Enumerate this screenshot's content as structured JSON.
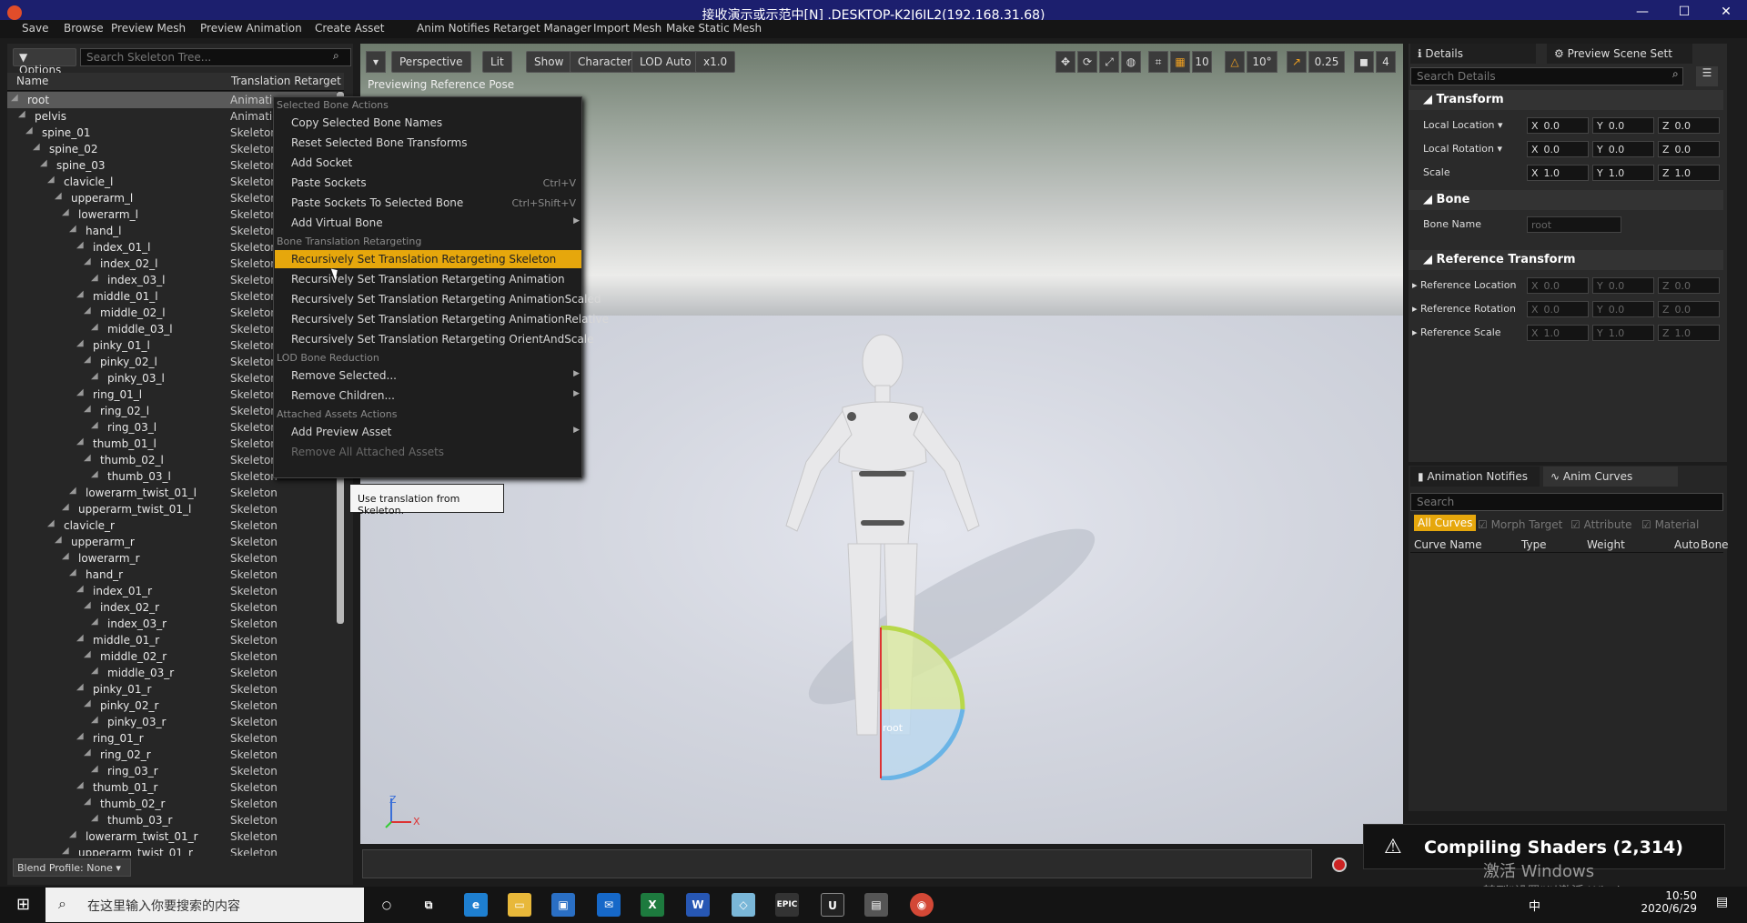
{
  "window": {
    "title": "接收演示或示范中[N] .DESKTOP-K2J6IL2(192.168.31.68)"
  },
  "menu": {
    "items": [
      "Save",
      "Browse",
      "Preview Mesh",
      "Preview Animation",
      "Create Asset",
      "Anim Notifies",
      "Retarget Manager",
      "Import Mesh",
      "Make Static Mesh"
    ]
  },
  "tree": {
    "options_label": "Options",
    "search_placeholder": "Search Skeleton Tree...",
    "col_name": "Name",
    "col_type": "Translation Retarget",
    "rows": [
      {
        "name": "root",
        "type": "Animatio",
        "indent": 0,
        "selected": true
      },
      {
        "name": "pelvis",
        "type": "Animatio",
        "indent": 1
      },
      {
        "name": "spine_01",
        "type": "Skeleton",
        "indent": 2
      },
      {
        "name": "spine_02",
        "type": "Skeleton",
        "indent": 3
      },
      {
        "name": "spine_03",
        "type": "Skeleton",
        "indent": 4
      },
      {
        "name": "clavicle_l",
        "type": "Skeleton",
        "indent": 5
      },
      {
        "name": "upperarm_l",
        "type": "Skeleton",
        "indent": 6
      },
      {
        "name": "lowerarm_l",
        "type": "Skeleton",
        "indent": 7
      },
      {
        "name": "hand_l",
        "type": "Skeleton",
        "indent": 8
      },
      {
        "name": "index_01_l",
        "type": "Skeleton",
        "indent": 9
      },
      {
        "name": "index_02_l",
        "type": "Skeleton",
        "indent": 10
      },
      {
        "name": "index_03_l",
        "type": "Skeleton",
        "indent": 11
      },
      {
        "name": "middle_01_l",
        "type": "Skeleton",
        "indent": 9
      },
      {
        "name": "middle_02_l",
        "type": "Skeleton",
        "indent": 10
      },
      {
        "name": "middle_03_l",
        "type": "Skeleton",
        "indent": 11
      },
      {
        "name": "pinky_01_l",
        "type": "Skeleton",
        "indent": 9
      },
      {
        "name": "pinky_02_l",
        "type": "Skeleton",
        "indent": 10
      },
      {
        "name": "pinky_03_l",
        "type": "Skeleton",
        "indent": 11
      },
      {
        "name": "ring_01_l",
        "type": "Skeleton",
        "indent": 9
      },
      {
        "name": "ring_02_l",
        "type": "Skeleton",
        "indent": 10
      },
      {
        "name": "ring_03_l",
        "type": "Skeleton",
        "indent": 11
      },
      {
        "name": "thumb_01_l",
        "type": "Skeleton",
        "indent": 9
      },
      {
        "name": "thumb_02_l",
        "type": "Skeleton",
        "indent": 10
      },
      {
        "name": "thumb_03_l",
        "type": "Skeleton",
        "indent": 11
      },
      {
        "name": "lowerarm_twist_01_l",
        "type": "Skeleton",
        "indent": 8
      },
      {
        "name": "upperarm_twist_01_l",
        "type": "Skeleton",
        "indent": 7
      },
      {
        "name": "clavicle_r",
        "type": "Skeleton",
        "indent": 5
      },
      {
        "name": "upperarm_r",
        "type": "Skeleton",
        "indent": 6
      },
      {
        "name": "lowerarm_r",
        "type": "Skeleton",
        "indent": 7
      },
      {
        "name": "hand_r",
        "type": "Skeleton",
        "indent": 8
      },
      {
        "name": "index_01_r",
        "type": "Skeleton",
        "indent": 9
      },
      {
        "name": "index_02_r",
        "type": "Skeleton",
        "indent": 10
      },
      {
        "name": "index_03_r",
        "type": "Skeleton",
        "indent": 11
      },
      {
        "name": "middle_01_r",
        "type": "Skeleton",
        "indent": 9
      },
      {
        "name": "middle_02_r",
        "type": "Skeleton",
        "indent": 10
      },
      {
        "name": "middle_03_r",
        "type": "Skeleton",
        "indent": 11
      },
      {
        "name": "pinky_01_r",
        "type": "Skeleton",
        "indent": 9
      },
      {
        "name": "pinky_02_r",
        "type": "Skeleton",
        "indent": 10
      },
      {
        "name": "pinky_03_r",
        "type": "Skeleton",
        "indent": 11
      },
      {
        "name": "ring_01_r",
        "type": "Skeleton",
        "indent": 9
      },
      {
        "name": "ring_02_r",
        "type": "Skeleton",
        "indent": 10
      },
      {
        "name": "ring_03_r",
        "type": "Skeleton",
        "indent": 11
      },
      {
        "name": "thumb_01_r",
        "type": "Skeleton",
        "indent": 9
      },
      {
        "name": "thumb_02_r",
        "type": "Skeleton",
        "indent": 10
      },
      {
        "name": "thumb_03_r",
        "type": "Skeleton",
        "indent": 11
      },
      {
        "name": "lowerarm_twist_01_r",
        "type": "Skeleton",
        "indent": 8
      },
      {
        "name": "upperarm_twist_01_r",
        "type": "Skeleton",
        "indent": 7
      }
    ],
    "blend_profile": "Blend Profile: None"
  },
  "viewport": {
    "perspective": "Perspective",
    "lit": "Lit",
    "show": "Show",
    "character": "Character",
    "lod": "LOD Auto",
    "speed": "x1.0",
    "grid_snap": "10",
    "rot_snap": "10°",
    "scale_snap": "0.25",
    "cam_speed": "4",
    "preview_text": "Previewing Reference Pose",
    "bone_label": "root",
    "axis_z": "Z",
    "axis_x": "X"
  },
  "context_menu": {
    "groups": [
      {
        "header": "Selected Bone Actions",
        "items": [
          {
            "label": "Copy Selected Bone Names"
          },
          {
            "label": "Reset Selected Bone Transforms"
          },
          {
            "label": "Add Socket"
          },
          {
            "label": "Paste Sockets",
            "shortcut": "Ctrl+V"
          },
          {
            "label": "Paste Sockets To Selected Bone",
            "shortcut": "Ctrl+Shift+V"
          },
          {
            "label": "Add Virtual Bone",
            "submenu": true
          }
        ]
      },
      {
        "header": "Bone Translation Retargeting",
        "items": [
          {
            "label": "Recursively Set Translation Retargeting Skeleton",
            "highlight": true
          },
          {
            "label": "Recursively Set Translation Retargeting Animation"
          },
          {
            "label": "Recursively Set Translation Retargeting AnimationScaled"
          },
          {
            "label": "Recursively Set Translation Retargeting AnimationRelative"
          },
          {
            "label": "Recursively Set Translation Retargeting OrientAndScale"
          }
        ]
      },
      {
        "header": "LOD Bone Reduction",
        "items": [
          {
            "label": "Remove Selected...",
            "submenu": true
          },
          {
            "label": "Remove Children...",
            "submenu": true
          }
        ]
      },
      {
        "header": "Attached Assets Actions",
        "items": [
          {
            "label": "Add Preview Asset",
            "submenu": true
          },
          {
            "label": "Remove All Attached Assets",
            "disabled": true
          }
        ]
      }
    ],
    "tooltip": "Use translation from Skeleton."
  },
  "details": {
    "tab_details": "Details",
    "tab_preview": "Preview Scene Sett",
    "search_placeholder": "Search Details",
    "transform_section": "Transform",
    "local_location": "Local Location",
    "local_rotation": "Local Rotation",
    "scale": "Scale",
    "loc": [
      "0.0",
      "0.0",
      "0.0"
    ],
    "rot": [
      "0.0",
      "0.0",
      "0.0"
    ],
    "scl": [
      "1.0",
      "1.0",
      "1.0"
    ],
    "bone_section": "Bone",
    "bone_name_label": "Bone Name",
    "bone_name_value": "root",
    "ref_section": "Reference Transform",
    "ref_location": "Reference Location",
    "ref_rotation": "Reference Rotation",
    "ref_scale": "Reference Scale",
    "rloc": [
      "0.0",
      "0.0",
      "0.0"
    ],
    "rrot": [
      "0.0",
      "0.0",
      "0.0"
    ],
    "rscl": [
      "1.0",
      "1.0",
      "1.0"
    ],
    "axis_x": "X",
    "axis_y": "Y",
    "axis_z": "Z"
  },
  "curves": {
    "tab_notifies": "Animation Notifies",
    "tab_curves": "Anim Curves",
    "search_placeholder": "Search",
    "filter_all": "All Curves",
    "filter_morph": "Morph Target",
    "filter_attr": "Attribute",
    "filter_mat": "Material",
    "col_name": "Curve Name",
    "col_type": "Type",
    "col_weight": "Weight",
    "col_auto": "Auto",
    "col_bone": "Bone"
  },
  "notification": {
    "text": "Compiling Shaders (2,314)"
  },
  "watermark": {
    "line1": "激活 Windows",
    "line2": "转到\"设置\"以激活 Windows。"
  },
  "taskbar": {
    "search_placeholder": "在这里输入你要搜索的内容",
    "time": "10:50",
    "date": "2020/6/29",
    "ime": "中"
  }
}
